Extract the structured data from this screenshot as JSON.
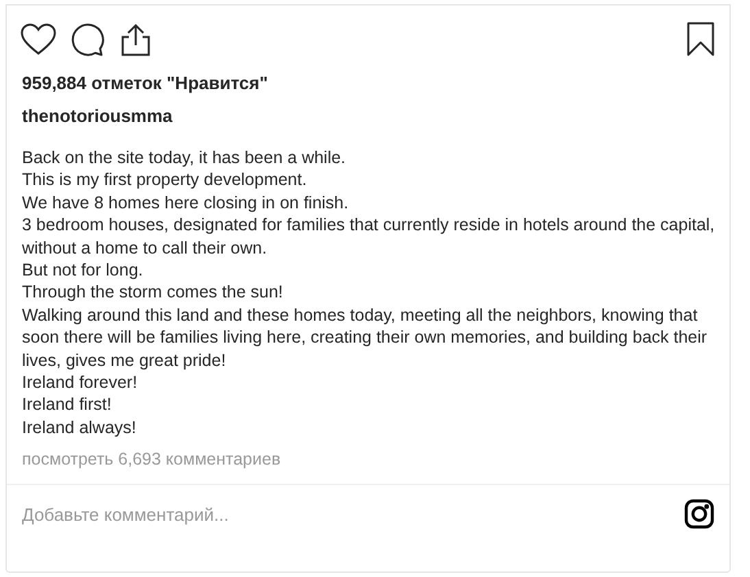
{
  "likes": "959,884 отметок \"Нравится\"",
  "username": "thenotoriousmma",
  "caption": [
    "Back on the site today, it has been a while.",
    "This is my first property development.",
    "We have 8 homes here closing in on finish.",
    "3 bedroom houses, designated for families that currently reside in hotels around the capital, without a home to call their own.",
    "But not for long.",
    "Through the storm comes the sun!",
    "Walking around this land and these homes today, meeting all the neighbors, knowing that soon there will be families living here, creating their own memories, and building back their lives, gives me great pride!",
    "Ireland forever!",
    "Ireland first!",
    "Ireland always!"
  ],
  "view_comments": "посмотреть 6,693 комментариев",
  "comment_field": {
    "placeholder": "Добавьте комментарий..."
  }
}
